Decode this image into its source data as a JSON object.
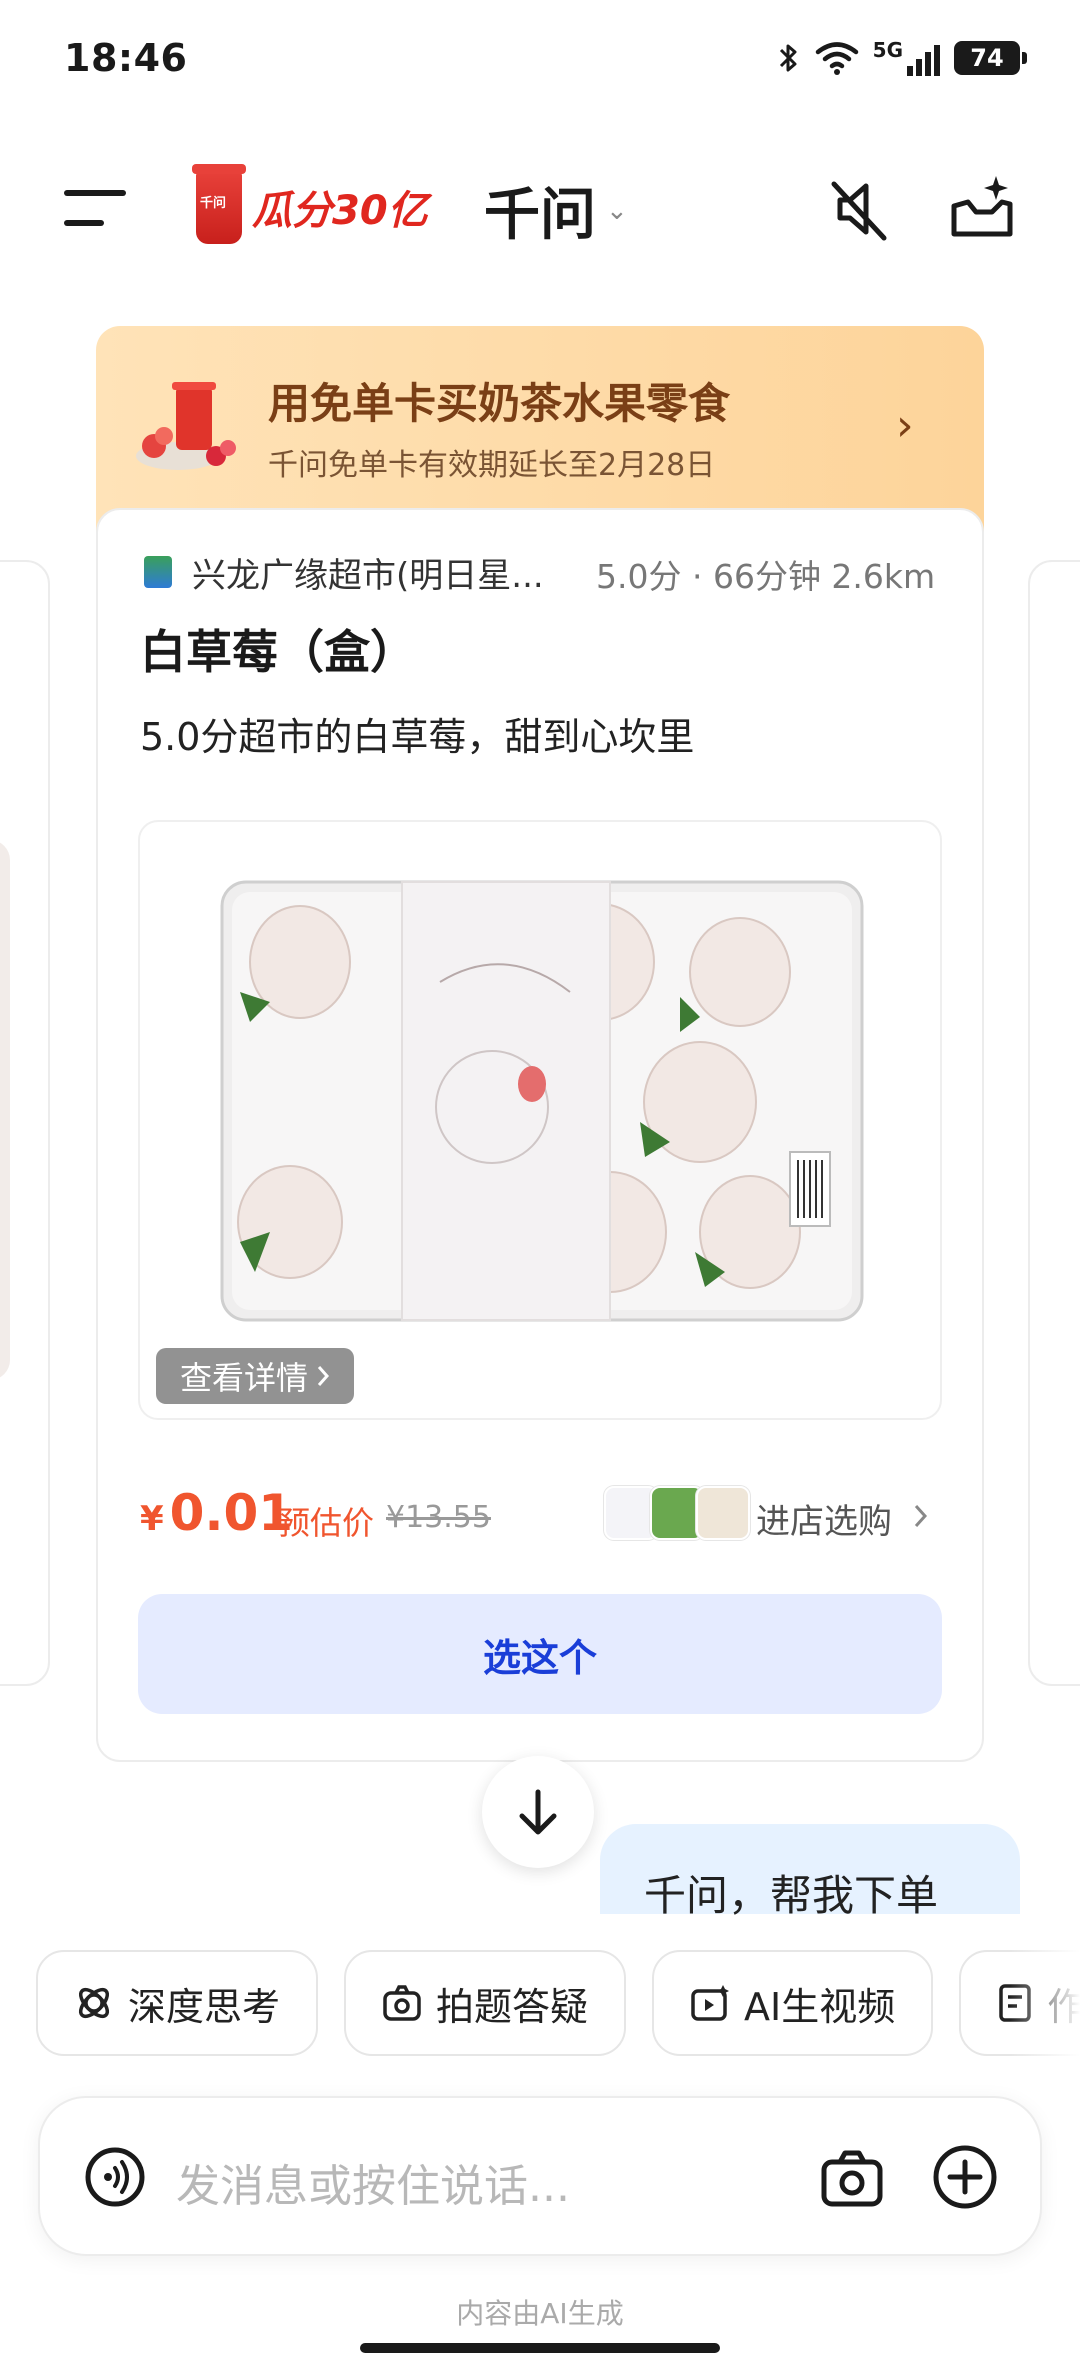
{
  "status_bar": {
    "time": "18:46",
    "network": "5G",
    "battery": "74"
  },
  "header": {
    "promo_text": "瓜分30亿",
    "promo_cup_text": "千问",
    "app_title": "千问",
    "title_chevron": "⌄"
  },
  "banner": {
    "title": "用免单卡买奶茶水果零食",
    "subtitle": "千问免单卡有效期延长至2月28日",
    "chevron": "›"
  },
  "product_card": {
    "store_name": "兴龙广缘超市(明日星...",
    "store_meta": "5.0分 · 66分钟 2.6km",
    "product_name": "白草莓（盒）",
    "description": "5.0分超市的白草莓，甜到心坎里",
    "view_details": "查看详情",
    "price_symbol": "¥",
    "price": "0.01",
    "price_label": "预估价",
    "original_price": "¥13.55",
    "store_link": "进店选购",
    "select_button": "选这个"
  },
  "chat": {
    "user_message": "千问，帮我下单"
  },
  "chips": [
    {
      "label": "深度思考",
      "icon": "brain-icon"
    },
    {
      "label": "拍题答疑",
      "icon": "camera-question-icon"
    },
    {
      "label": "AI生视频",
      "icon": "video-spark-icon"
    },
    {
      "label": "作",
      "icon": "document-icon"
    }
  ],
  "input": {
    "placeholder": "发消息或按住说话..."
  },
  "footer": {
    "note": "内容由AI生成"
  },
  "colors": {
    "accent_blue": "#1a3ed8",
    "price_orange": "#f0552e",
    "banner": "#fdd49a",
    "promo_red": "#e0271f"
  }
}
